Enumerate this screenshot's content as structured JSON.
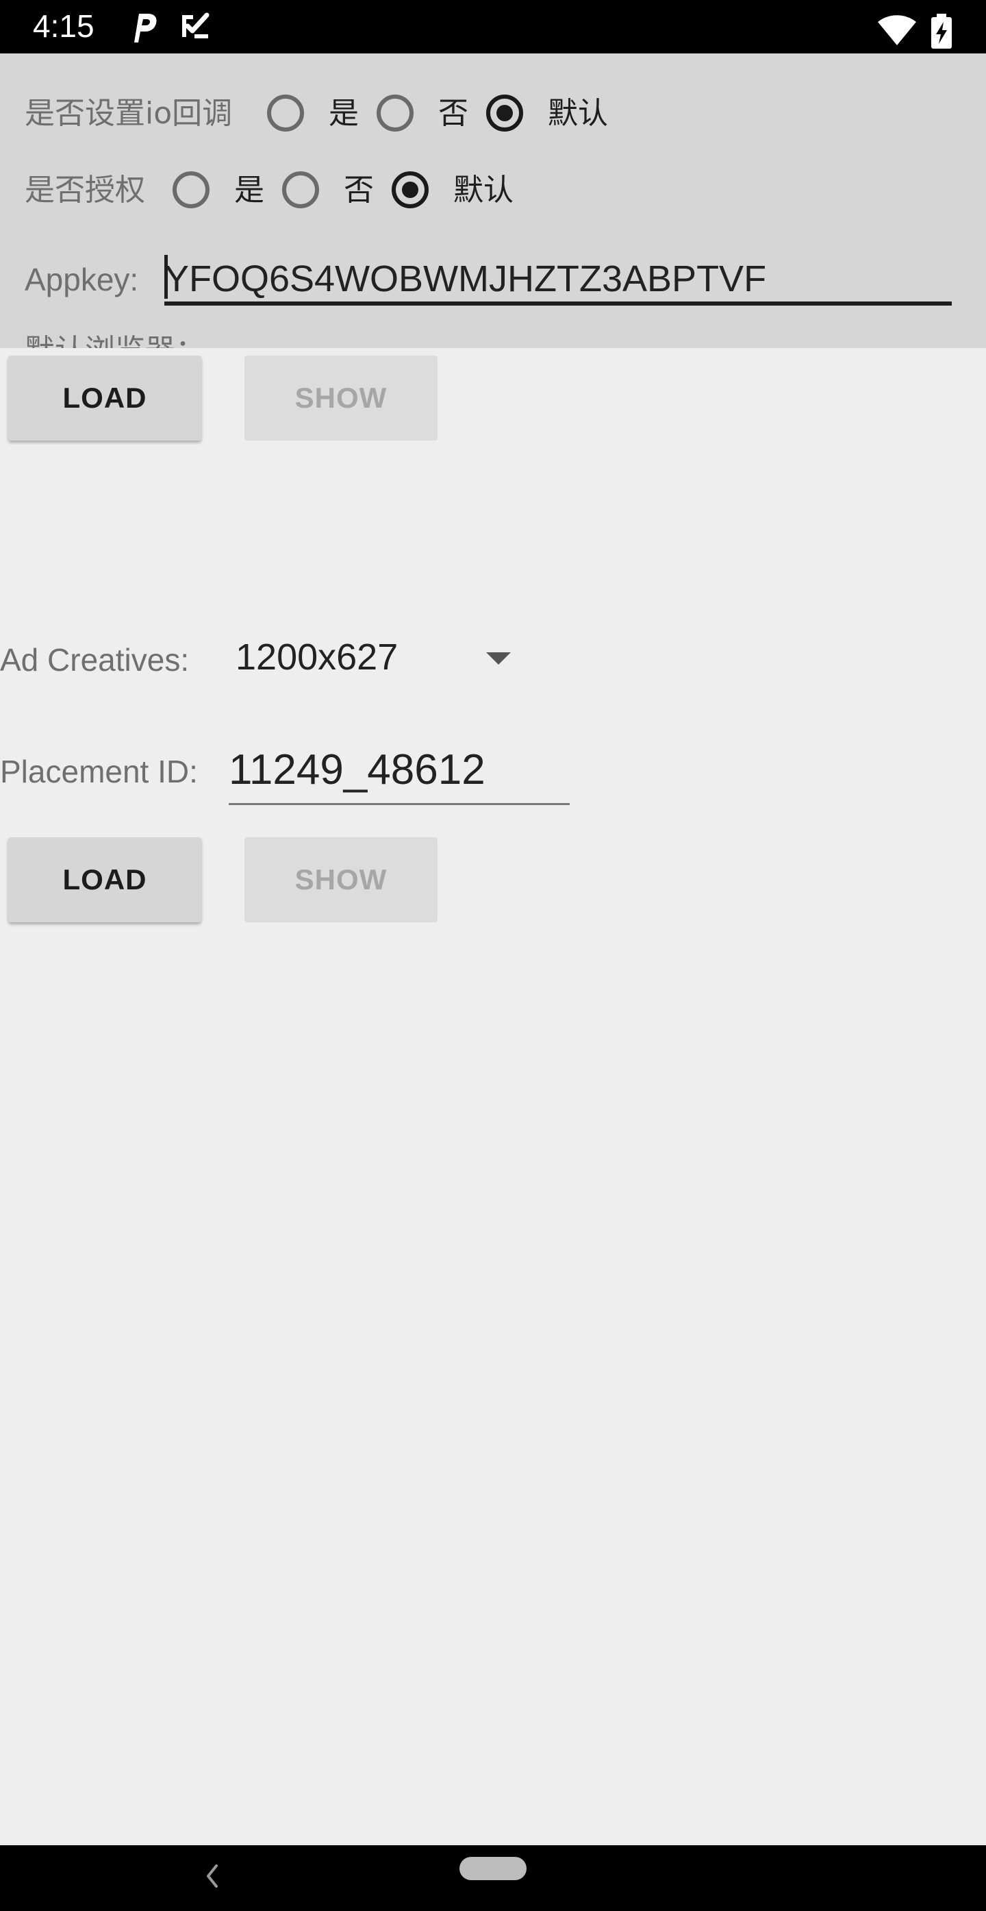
{
  "status_bar": {
    "time": "4:15",
    "icons": [
      "p-notification-icon",
      "task-check-icon",
      "wifi-icon",
      "battery-charging-icon"
    ]
  },
  "settings": {
    "io_callback": {
      "label": "是否设置io回调",
      "options": [
        "是",
        "否",
        "默认"
      ],
      "selected": "默认"
    },
    "authorize": {
      "label": "是否授权",
      "options": [
        "是",
        "否",
        "默认"
      ],
      "selected": "默认"
    },
    "appkey": {
      "label": "Appkey:",
      "value": "YFOQ6S4WOBWMJHZTZ3ABPTVF"
    },
    "clipped_label": "默认浏览器："
  },
  "top_buttons": {
    "load_label": "LOAD",
    "show_label": "SHOW",
    "show_enabled": false
  },
  "ad_creatives": {
    "label": "Ad Creatives:",
    "value": "1200x627"
  },
  "placement": {
    "label": "Placement ID:",
    "value": "11249_48612"
  },
  "bottom_buttons": {
    "load_label": "LOAD",
    "show_label": "SHOW",
    "show_enabled": false
  },
  "nav_bar": {
    "icons": [
      "back-icon",
      "home-pill-icon"
    ]
  }
}
